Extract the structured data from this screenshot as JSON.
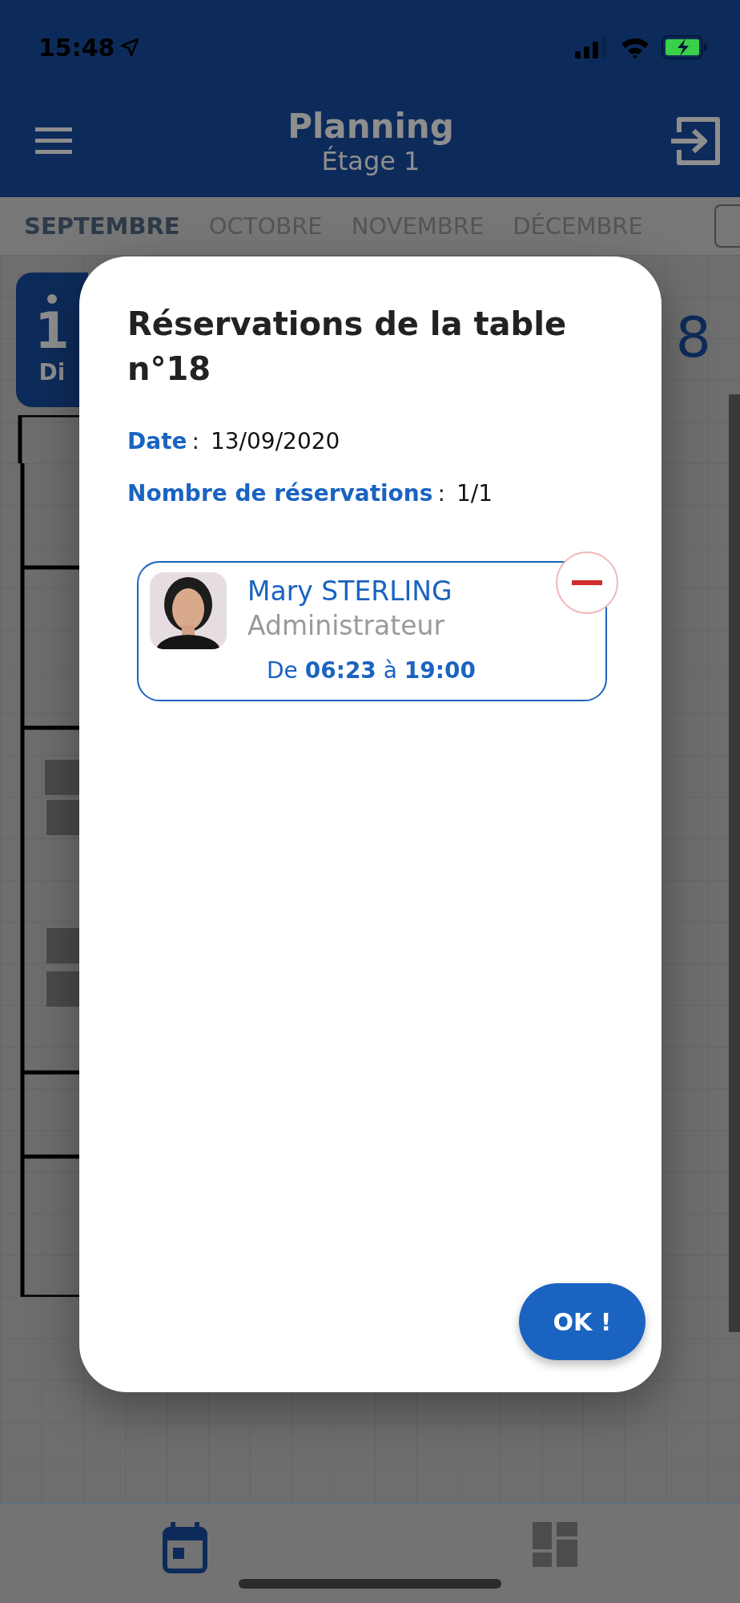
{
  "status_bar": {
    "time": "15:48"
  },
  "header": {
    "title": "Planning",
    "subtitle": "Étage 1"
  },
  "months": [
    {
      "label": "SEPTEMBRE",
      "selected": true
    },
    {
      "label": "OCTOBRE",
      "selected": false
    },
    {
      "label": "NOVEMBRE",
      "selected": false
    },
    {
      "label": "DÉCEMBRE",
      "selected": false
    }
  ],
  "day_strip": {
    "day": "1",
    "weekday": "Di",
    "trailing_digit": "8"
  },
  "dialog": {
    "title": "Réservations de la table n°18",
    "fields": [
      {
        "label": "Date",
        "separator": ":",
        "value": "13/09/2020"
      },
      {
        "label": "Nombre de réservations",
        "separator": ":",
        "value": "1/1"
      }
    ],
    "reservations": [
      {
        "name": "Mary STERLING",
        "role": "Administrateur",
        "time": "De **06:23** à **19:00**"
      }
    ],
    "button": "OK !"
  },
  "bottom_nav": [
    {
      "kind": "calendar",
      "selected": true
    },
    {
      "kind": "dashboard",
      "selected": false
    }
  ]
}
